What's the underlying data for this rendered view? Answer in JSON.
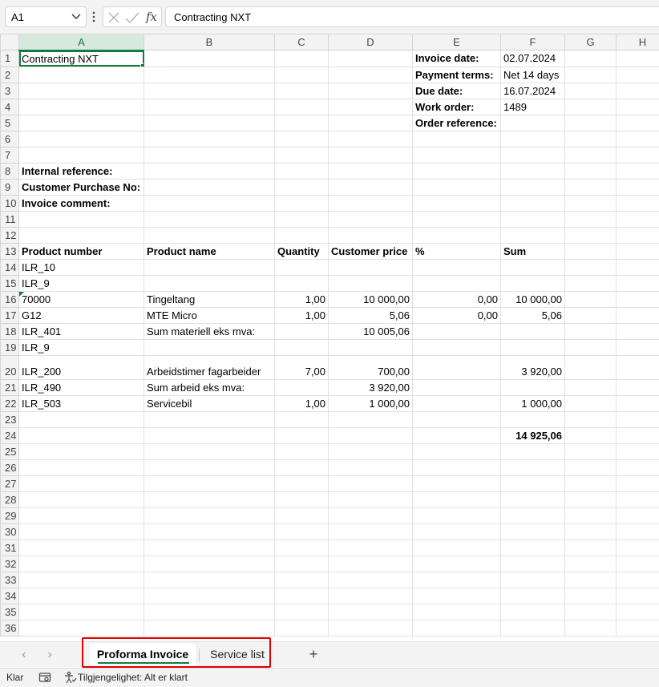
{
  "namebox": {
    "value": "A1"
  },
  "formula": {
    "fx": "fx",
    "value": "Contracting NXT"
  },
  "columns": [
    "A",
    "B",
    "C",
    "D",
    "E",
    "F",
    "G",
    "H"
  ],
  "active_column": "A",
  "rows": [
    {
      "n": "1",
      "A": "Contracting NXT",
      "E": "Invoice date:",
      "F": "02.07.2024"
    },
    {
      "n": "2",
      "E": "Payment terms:",
      "F": "Net 14 days"
    },
    {
      "n": "3",
      "E": "Due date:",
      "F": "16.07.2024"
    },
    {
      "n": "4",
      "E": "Work order:",
      "F": "1489"
    },
    {
      "n": "5",
      "E": "Order reference:"
    },
    {
      "n": "6"
    },
    {
      "n": "7"
    },
    {
      "n": "8",
      "A": "Internal reference:"
    },
    {
      "n": "9",
      "A": "Customer Purchase No:"
    },
    {
      "n": "10",
      "A": "Invoice comment:"
    },
    {
      "n": "11"
    },
    {
      "n": "12"
    },
    {
      "n": "13",
      "A": "Product number",
      "B": "Product name",
      "C": "Quantity",
      "D": "Customer price",
      "E": "%",
      "F": "Sum"
    },
    {
      "n": "14",
      "A": "ILR_10"
    },
    {
      "n": "15",
      "A": "ILR_9"
    },
    {
      "n": "16",
      "A": "70000",
      "B": "Tingeltang",
      "C": "1,00",
      "D": "10 000,00",
      "E": "0,00",
      "F": "10 000,00"
    },
    {
      "n": "17",
      "A": "G12",
      "B": "MTE Micro",
      "C": "1,00",
      "D": "5,06",
      "E": "0,00",
      "F": "5,06"
    },
    {
      "n": "18",
      "A": "ILR_401",
      "B": "Sum materiell eks mva:",
      "D": "10 005,06"
    },
    {
      "n": "19",
      "A": "ILR_9"
    },
    {
      "n": "20",
      "A": "ILR_200",
      "B": "Arbeidstimer fagarbeider",
      "C": "7,00",
      "D": "700,00",
      "F": "3 920,00"
    },
    {
      "n": "21",
      "A": "ILR_490",
      "B": "Sum arbeid eks mva:",
      "D": "3 920,00"
    },
    {
      "n": "22",
      "A": "ILR_503",
      "B": "Servicebil",
      "C": "1,00",
      "D": "1 000,00",
      "F": "1 000,00"
    },
    {
      "n": "23"
    },
    {
      "n": "24",
      "F": "14 925,06"
    },
    {
      "n": "25"
    },
    {
      "n": "26"
    },
    {
      "n": "27"
    },
    {
      "n": "28"
    },
    {
      "n": "29"
    },
    {
      "n": "30"
    },
    {
      "n": "31"
    },
    {
      "n": "32"
    },
    {
      "n": "33"
    },
    {
      "n": "34"
    },
    {
      "n": "35"
    },
    {
      "n": "36"
    }
  ],
  "sheet_tabs": {
    "active": "Proforma Invoice",
    "other": "Service list",
    "add": "+"
  },
  "status": {
    "ready": "Klar",
    "accessibility": "Tilgjengelighet: Alt er klart"
  },
  "colors": {
    "accent": "#107c41",
    "highlight": "#e00000"
  }
}
